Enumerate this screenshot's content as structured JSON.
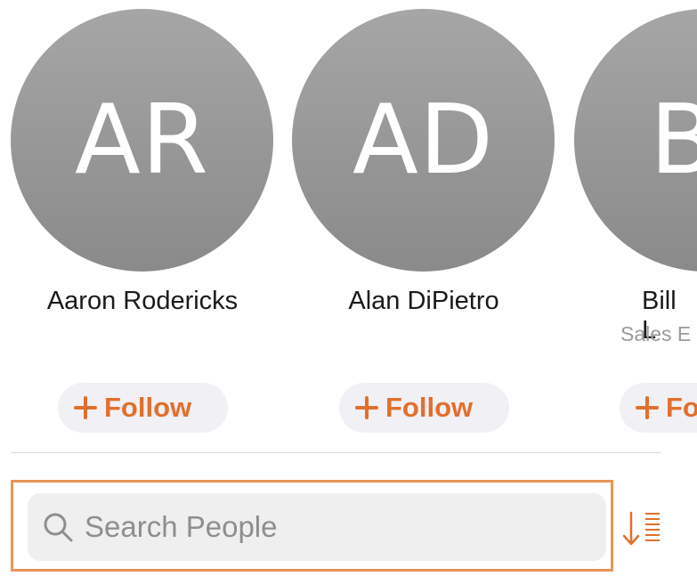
{
  "people": [
    {
      "initials": "AR",
      "name": "Aaron Rodericks",
      "subtitle": "",
      "follow_label": "Follow"
    },
    {
      "initials": "AD",
      "name": "Alan DiPietro",
      "subtitle": "",
      "follow_label": "Follow"
    },
    {
      "initials": "B",
      "name": "Bill L",
      "subtitle": "Sales E",
      "follow_label": "Fo"
    }
  ],
  "search": {
    "placeholder": "Search People",
    "value": ""
  },
  "icons": {
    "search": "search-icon",
    "sort": "sort-icon",
    "follow": "plus-icon"
  },
  "colors": {
    "accent": "#e0702e",
    "avatar": "#999999",
    "highlight": "#e89458"
  }
}
